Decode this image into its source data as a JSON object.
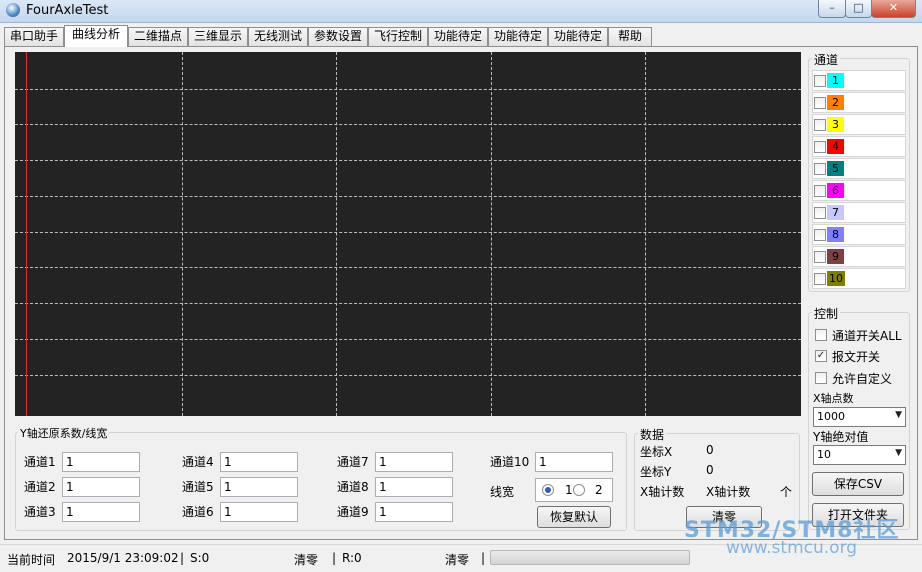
{
  "window": {
    "title": "FourAxleTest",
    "min": "–",
    "max": "□",
    "close": "✕"
  },
  "tabs": [
    "串口助手",
    "曲线分析",
    "二维描点",
    "三维显示",
    "无线测试",
    "参数设置",
    "飞行控制",
    "功能待定",
    "功能待定",
    "功能待定",
    "帮助"
  ],
  "channels_group": {
    "label": "通道"
  },
  "channels": [
    {
      "num": "1",
      "color": "#00ffff"
    },
    {
      "num": "2",
      "color": "#ff8000"
    },
    {
      "num": "3",
      "color": "#ffff00"
    },
    {
      "num": "4",
      "color": "#ff0000"
    },
    {
      "num": "5",
      "color": "#008080"
    },
    {
      "num": "6",
      "color": "#ff00ff"
    },
    {
      "num": "7",
      "color": "#c8c8ff"
    },
    {
      "num": "8",
      "color": "#8080ff"
    },
    {
      "num": "9",
      "color": "#804040"
    },
    {
      "num": "10",
      "color": "#808000"
    }
  ],
  "control": {
    "label": "控制",
    "all_channels": "通道开关ALL",
    "message_switch": "报文开关",
    "allow_custom": "允许自定义",
    "x_points_label": "X轴点数",
    "x_points_value": "1000",
    "y_abs_label": "Y轴绝对值",
    "y_abs_value": "10",
    "save_csv": "保存CSV",
    "open_folder": "打开文件夹"
  },
  "yaxis": {
    "label": "Y轴还原系数/线宽",
    "fields": [
      {
        "label": "通道1",
        "value": "1"
      },
      {
        "label": "通道2",
        "value": "1"
      },
      {
        "label": "通道3",
        "value": "1"
      },
      {
        "label": "通道4",
        "value": "1"
      },
      {
        "label": "通道5",
        "value": "1"
      },
      {
        "label": "通道6",
        "value": "1"
      },
      {
        "label": "通道7",
        "value": "1"
      },
      {
        "label": "通道8",
        "value": "1"
      },
      {
        "label": "通道9",
        "value": "1"
      },
      {
        "label": "通道10",
        "value": "1"
      }
    ],
    "linewidth_label": "线宽",
    "lw1": "1",
    "lw2": "2",
    "restore": "恢复默认"
  },
  "data_group": {
    "label": "数据",
    "coord_x_label": "坐标X",
    "coord_x_value": "0",
    "coord_y_label": "坐标Y",
    "coord_y_value": "0",
    "x_count_label": "X轴计数",
    "x_count_value": "X轴计数",
    "x_count_unit": "个",
    "clear": "清零"
  },
  "status": {
    "time_label": "当前时间",
    "time_value": "2015/9/1 23:09:02",
    "sep": "|",
    "s": "S:0",
    "clear1": "清零",
    "r": "R:0",
    "clear2": "清零"
  },
  "watermark": {
    "line1": "STM32/STM8社区",
    "line2": "www.stmcu.org"
  }
}
